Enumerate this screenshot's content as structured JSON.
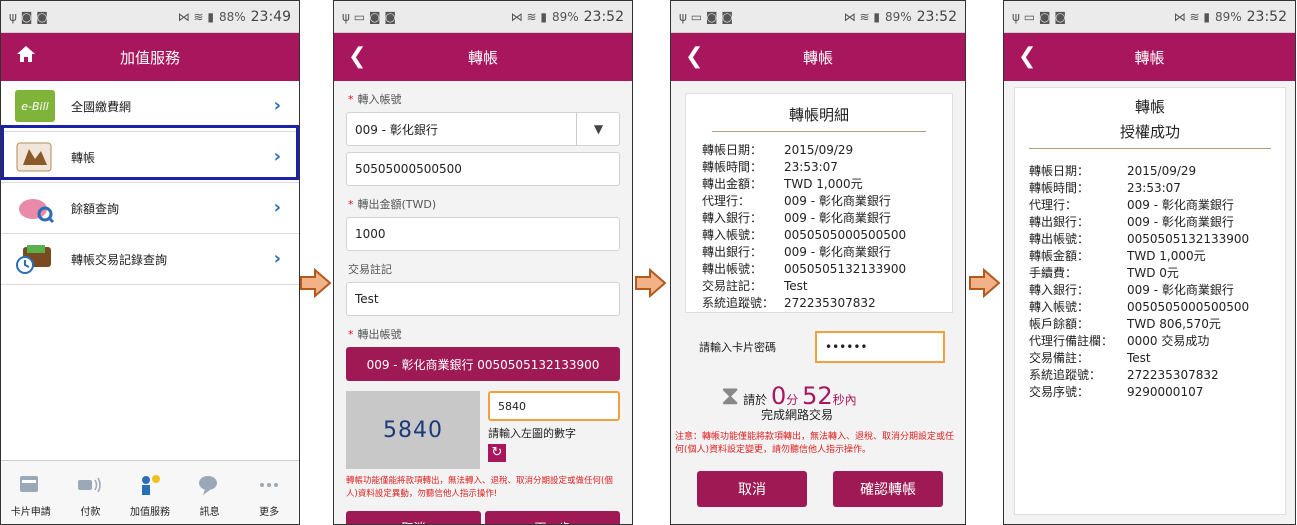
{
  "status": {
    "s1": {
      "icons_left": "ψ ◙ ◙",
      "signal": "⋈ ≋ ▮",
      "battery": "88%",
      "time": "23:49"
    },
    "s2": {
      "icons_left": "ψ ▭ ◙ ◙",
      "signal": "⋈ ≋ ▮",
      "battery": "89%",
      "time": "23:52"
    },
    "s3": {
      "icons_left": "ψ ▭ ◙ ◙",
      "signal": "⋈ ≋ ▮",
      "battery": "89%",
      "time": "23:52"
    },
    "s4": {
      "icons_left": "ψ ▭ ◙ ◙",
      "signal": "⋈ ≋ ▮",
      "battery": "89%",
      "time": "23:52"
    }
  },
  "colors": {
    "brand": "#a8175d",
    "button": "#9f1a55",
    "highlight": "#1a22a8",
    "arrow": "#f2b187",
    "accent_orange": "#f0a040"
  },
  "screen1": {
    "title": "加值服務",
    "home_icon": "home-icon",
    "menu": [
      {
        "label": "全國繳費網",
        "icon_text": "e-Bill",
        "icon": "ebill-icon"
      },
      {
        "label": "轉帳",
        "icon": "transfer-icon"
      },
      {
        "label": "餘額查詢",
        "icon": "piggy-bank-icon"
      },
      {
        "label": "轉帳交易記錄查詢",
        "icon": "wallet-clock-icon"
      }
    ],
    "nav": [
      {
        "label": "卡片申請",
        "icon": "card-apply-icon"
      },
      {
        "label": "付款",
        "icon": "nfc-pay-icon"
      },
      {
        "label": "加值服務",
        "icon": "value-added-icon"
      },
      {
        "label": "訊息",
        "icon": "message-icon"
      },
      {
        "label": "更多",
        "icon": "more-icon"
      }
    ]
  },
  "screen2": {
    "title": "轉帳",
    "in_account_label": "轉入帳號",
    "bank_value": "009 - 彰化銀行",
    "account_value": "50505000500500",
    "amount_label": "轉出金額(TWD)",
    "amount_value": "1000",
    "memo_label": "交易註記",
    "memo_value": "Test",
    "out_account_label": "轉出帳號",
    "out_account_value": "009 - 彰化商業銀行 0050505132133900",
    "captcha_image": "5840",
    "captcha_input": "5840",
    "captcha_hint": "請輸入左圖的數字",
    "warning": "轉帳功能僅能將款項轉出，無法轉入、退稅、取消分期設定或做任何(個人)資料設定異動，勿聽信他人指示操作!",
    "cancel": "取消",
    "next": "下一步"
  },
  "screen3": {
    "title": "轉帳",
    "card_title": "轉帳明細",
    "rows": [
      {
        "k": "轉帳日期：",
        "v": "2015/09/29"
      },
      {
        "k": "轉帳時間：",
        "v": "23:53:07"
      },
      {
        "k": "轉出金額：",
        "v": "TWD 1,000元"
      },
      {
        "k": "代理行：",
        "v": "009 - 彰化商業銀行"
      },
      {
        "k": "轉入銀行：",
        "v": "009 - 彰化商業銀行"
      },
      {
        "k": "轉入帳號：",
        "v": "0050505000500500"
      },
      {
        "k": "轉出銀行：",
        "v": "009 - 彰化商業銀行"
      },
      {
        "k": "轉出帳號：",
        "v": "0050505132133900"
      },
      {
        "k": "交易註記：",
        "v": "Test"
      },
      {
        "k": "系統追蹤號：",
        "v": "272235307832"
      }
    ],
    "pin_label": "請輸入卡片密碼",
    "pin_value": "••••••",
    "timer_prefix": "請於",
    "timer_min": "0",
    "timer_min_unit": "分",
    "timer_sec": "52",
    "timer_sec_unit": "秒內",
    "timer_suffix": "完成網路交易",
    "notice": "注意：轉帳功能僅能將款項轉出，無法轉入、退稅、取消分期設定或任何(個人)資料設定變更，請勿聽信他人指示操作。",
    "cancel": "取消",
    "confirm": "確認轉帳"
  },
  "screen4": {
    "title": "轉帳",
    "card_title1": "轉帳",
    "card_title2": "授權成功",
    "rows": [
      {
        "k": "轉帳日期：",
        "v": "2015/09/29"
      },
      {
        "k": "轉帳時間：",
        "v": "23:53:07"
      },
      {
        "k": "代理行：",
        "v": "009 - 彰化商業銀行"
      },
      {
        "k": "轉出銀行：",
        "v": "009 - 彰化商業銀行"
      },
      {
        "k": "轉出帳號：",
        "v": "0050505132133900"
      },
      {
        "k": "轉帳金額：",
        "v": "TWD 1,000元"
      },
      {
        "k": "手續費：",
        "v": "TWD 0元"
      },
      {
        "k": "轉入銀行：",
        "v": "009 - 彰化商業銀行"
      },
      {
        "k": "轉入帳號：",
        "v": "0050505000500500"
      },
      {
        "k": "帳戶餘額：",
        "v": "TWD 806,570元"
      },
      {
        "k": "代理行備註欄：",
        "v": "0000 交易成功"
      },
      {
        "k": "交易備註：",
        "v": "Test"
      },
      {
        "k": "系統追蹤號：",
        "v": "272235307832"
      },
      {
        "k": "交易序號：",
        "v": "9290000107"
      }
    ]
  }
}
